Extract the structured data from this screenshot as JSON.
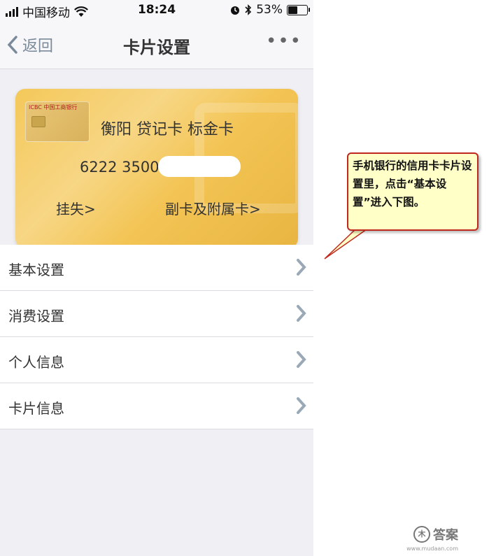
{
  "status": {
    "carrier": "中国移动",
    "time": "18:24",
    "battery_text": "53%",
    "battery_level": 0.53
  },
  "nav": {
    "back_label": "返回",
    "title": "卡片设置",
    "more_label": "•••"
  },
  "card": {
    "name": "衡阳 贷记卡 标金卡",
    "number": "6222 3500",
    "bank_logo": "ICBC 中国工商银行",
    "left_link": "挂失>",
    "right_link": "副卡及附属卡>"
  },
  "menu": {
    "items": [
      {
        "label": "基本设置"
      },
      {
        "label": "消费设置"
      },
      {
        "label": "个人信息"
      },
      {
        "label": "卡片信息"
      }
    ]
  },
  "annotation": {
    "text": "手机银行的信用卡卡片设置里，点击“基本设置”进入下图。"
  },
  "watermark": {
    "text": "答案",
    "url": "www.mudaan.com"
  },
  "colors": {
    "accent": "#c0281e",
    "card_gold": "#f4c85a",
    "chevron": "#9aa9b5"
  }
}
